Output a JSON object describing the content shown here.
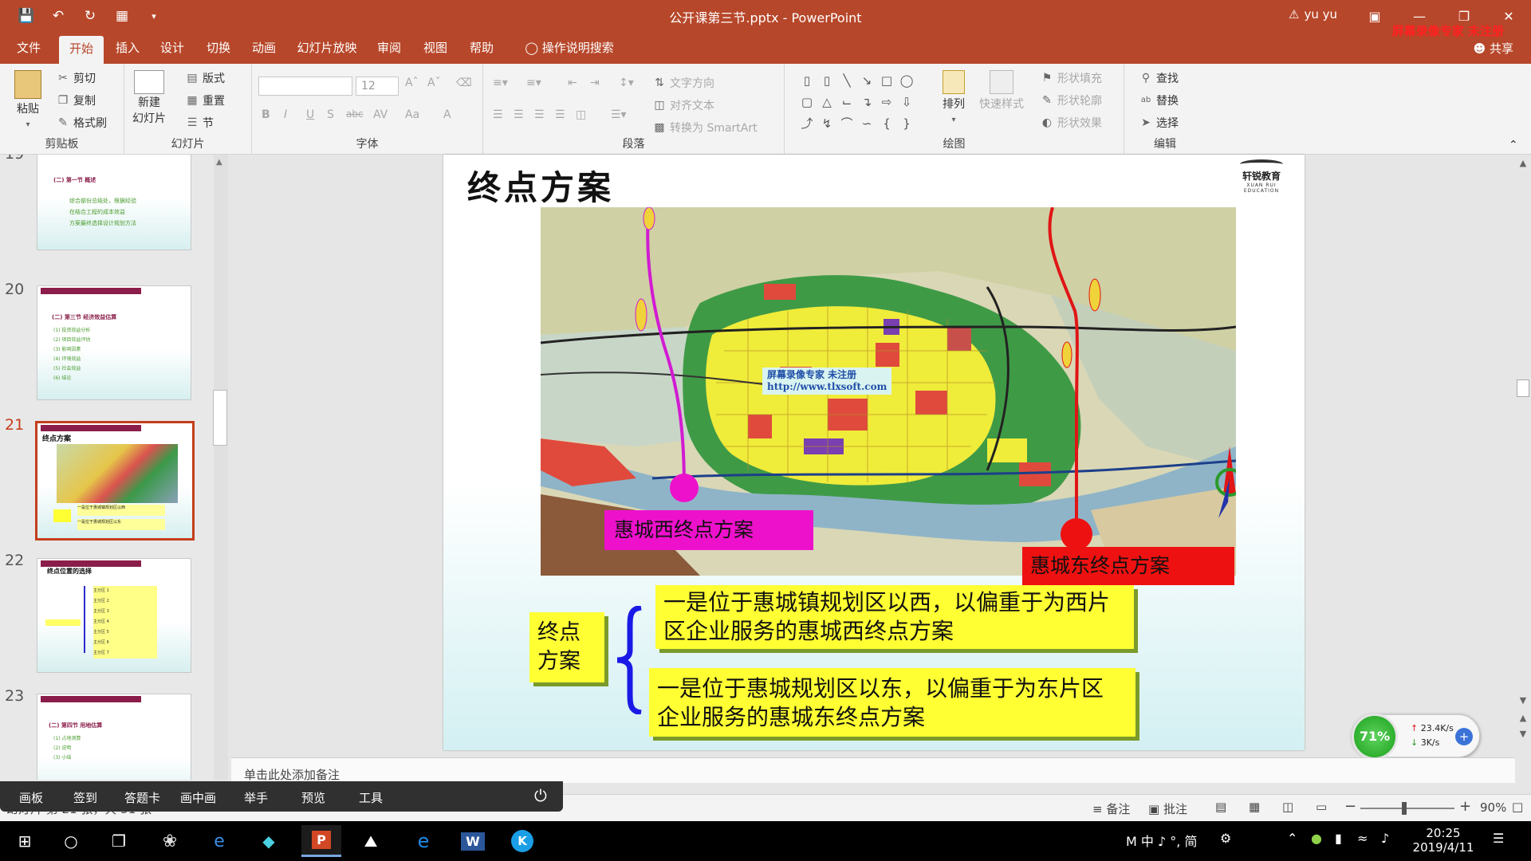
{
  "app": {
    "title": "公开课第三节.pptx - PowerPoint",
    "user_name": "yu yu",
    "warning_icon": "warning-triangle-icon",
    "recorder_watermark": "屏幕录像专家 未注册",
    "share_label": "共享"
  },
  "tabs": [
    "文件",
    "开始",
    "插入",
    "设计",
    "切换",
    "动画",
    "幻灯片放映",
    "审阅",
    "视图",
    "帮助",
    "操作说明搜索"
  ],
  "active_tab_index": 1,
  "ribbon": {
    "clipboard": {
      "label": "剪贴板",
      "paste": "粘贴",
      "cut": "剪切",
      "copy": "复制",
      "format_painter": "格式刷"
    },
    "slides": {
      "label": "幻灯片",
      "new_slide_line1": "新建",
      "new_slide_line2": "幻灯片",
      "layout": "版式",
      "reset": "重置",
      "section": "节"
    },
    "font": {
      "label": "字体",
      "font_name": "",
      "font_size": "12",
      "bold": "B",
      "italic": "I",
      "underline": "U",
      "shadow": "S",
      "strikethrough": "abc",
      "spacing": "AV",
      "case": "Aa",
      "color": "A"
    },
    "paragraph": {
      "label": "段落",
      "text_direction": "文字方向",
      "align_text": "对齐文本",
      "smartart": "转换为 SmartArt"
    },
    "drawing": {
      "label": "绘图",
      "arrange": "排列",
      "quick_styles": "快速样式",
      "shape_fill": "形状填充",
      "shape_outline": "形状轮廓",
      "shape_effects": "形状效果"
    },
    "editing": {
      "label": "编辑",
      "find": "查找",
      "replace": "替换",
      "select": "选择"
    }
  },
  "thumbnails": [
    {
      "number": "19",
      "title": "(二) 第一节 概述",
      "lines": [
        "综合部份总结处，根据经验",
        "在结合工程的成本效益",
        "方案最终选择设计规划方法"
      ]
    },
    {
      "number": "20",
      "title": "(二) 第三节 经济效益估算",
      "lines": [
        "(1) 投资效益分析",
        "(2) 项目效益评估",
        "(3) 影响因素",
        "(4) 环境效益",
        "(5) 社会效益",
        "(6) 结论"
      ]
    },
    {
      "number": "21",
      "title": "终点方案",
      "lines": [
        "一是位于惠城镇规划区以西",
        "一是位于惠城规划区以东"
      ]
    },
    {
      "number": "22",
      "title": "终点位置的选择",
      "lines": [
        "主分区 1",
        "主分区 2",
        "主分区 3",
        "主分区 4",
        "主分区 5",
        "主分区 6",
        "主分区 7"
      ]
    },
    {
      "number": "23",
      "title": "(二) 第四节 用地估算",
      "lines": [
        "(1) 占地测算",
        "(2) 说明",
        "(3) 小结"
      ]
    }
  ],
  "current_slide_index": 2,
  "slide": {
    "title": "终点方案",
    "logo_text": "轩锐教育",
    "logo_sub": "XUAN RUI EDUCATION",
    "map_watermark_line1": "屏幕录像专家    未注册",
    "map_watermark_line2": "http://www.tlxsoft.com",
    "west_label": "惠城西终点方案",
    "east_label": "惠城东终点方案",
    "concept_label_line1": "终点",
    "concept_label_line2": "方案",
    "option1_line1": "一是位于惠城镇规划区以西，以偏重于为西片",
    "option1_line2": "区企业服务的惠城西终点方案",
    "option2_line1": "一是位于惠城规划区以东，以偏重于为东片区",
    "option2_line2": "企业服务的惠城东终点方案",
    "west_color": "#ee11cc",
    "east_color": "#ee1111",
    "highlight_color": "#ffff33"
  },
  "notes_placeholder": "单击此处添加备注",
  "status": {
    "slide_info": "幻灯片 第 21 张，共 51 张",
    "notes_btn": "备注",
    "comments_btn": "批注",
    "zoom": "90%"
  },
  "tool_panel": [
    "画板",
    "签到",
    "答题卡",
    "画中画",
    "举手",
    "预览",
    "工具"
  ],
  "network": {
    "percent": "71%",
    "up": "23.4K/s",
    "down": "3K/s"
  },
  "taskbar": {
    "ime_text": "M 中 ♪ °, 简",
    "time": "20:25",
    "date": "2019/4/11"
  },
  "colors": {
    "ppt_accent": "#b7472a",
    "current_thumb_border": "#c43e1c"
  }
}
